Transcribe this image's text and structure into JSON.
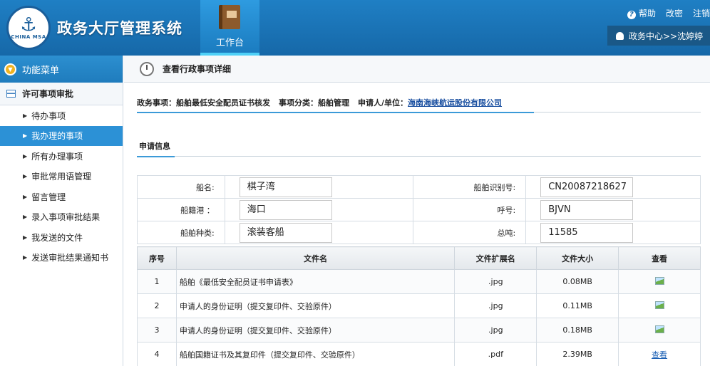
{
  "header": {
    "logo_text": "CHINA MSA",
    "system_title": "政务大厅管理系统",
    "workbench_label": "工作台",
    "links": {
      "help": "帮助",
      "change_password": "改密",
      "logout": "注销"
    },
    "user_path": "政务中心>>沈婷婷"
  },
  "sidebar": {
    "header": "功能菜单",
    "group": "许可事项审批",
    "items": [
      {
        "label": "待办事项"
      },
      {
        "label": "我办理的事项"
      },
      {
        "label": "所有办理事项"
      },
      {
        "label": "审批常用语管理"
      },
      {
        "label": "留言管理"
      },
      {
        "label": "录入事项审批结果"
      },
      {
        "label": "我发送的文件"
      },
      {
        "label": "发送审批结果通知书"
      }
    ]
  },
  "main": {
    "breadcrumb": "查看行政事项详细",
    "info": {
      "matter_label": "政务事项：",
      "matter_value": "船舶最低安全配员证书核发",
      "category_label": "事项分类：",
      "category_value": "船舶管理",
      "applicant_label": "申请人/单位：",
      "applicant_value": "海南海峡航运股份有限公司"
    },
    "tab": "申请信息",
    "form": {
      "ship_name_label": "船名:",
      "ship_name": "棋子湾",
      "ship_id_label": "船舶识别号:",
      "ship_id": "CN20087218627",
      "port_label": "船籍港 ：",
      "port": "海口",
      "callsign_label": "呼号:",
      "callsign": "BJVN",
      "type_label": "船舶种类:",
      "type": "滚装客船",
      "tonnage_label": "总吨:",
      "tonnage": "11585"
    },
    "files": {
      "headers": [
        "序号",
        "文件名",
        "文件扩展名",
        "文件大小",
        "查看"
      ],
      "rows": [
        {
          "no": "1",
          "name": "船舶《最低安全配员证书申请表》",
          "ext": ".jpg",
          "size": "0.08MB"
        },
        {
          "no": "2",
          "name": "申请人的身份证明（提交复印件、交验原件）",
          "ext": ".jpg",
          "size": "0.11MB"
        },
        {
          "no": "3",
          "name": "申请人的身份证明（提交复印件、交验原件）",
          "ext": ".jpg",
          "size": "0.18MB"
        },
        {
          "no": "4",
          "name": "船舶国籍证书及其复印件（提交复印件、交验原件）",
          "ext": ".pdf",
          "size": "2.39MB",
          "view_text": "查看"
        }
      ]
    }
  }
}
